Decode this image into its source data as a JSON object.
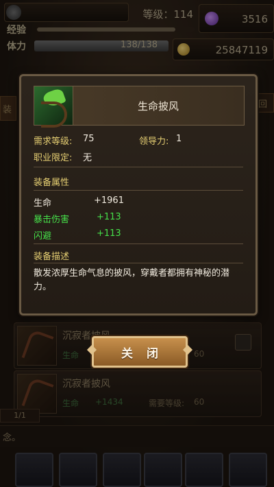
{
  "hud": {
    "player_name": "",
    "level_label": "等级：",
    "level": "114",
    "gems": "3516",
    "exp_label": "经验",
    "exp_fraction": 0.88,
    "hp_label": "体力",
    "hp_value": "138/138",
    "hp_fraction": 1.0,
    "gold": "25847119"
  },
  "side": {
    "left_tab": "装",
    "right_tab": "回"
  },
  "modal": {
    "item_name": "生命披风",
    "req_level_label": "需求等级:",
    "req_level": "75",
    "leadership_label": "领导力:",
    "leadership": "1",
    "job_label": "职业限定:",
    "job": "无",
    "attr_header": "装备属性",
    "attrs": [
      {
        "name": "生命",
        "value": "+1961"
      },
      {
        "name": "暴击伤害",
        "value": "+113"
      },
      {
        "name": "闪避",
        "value": "+113"
      }
    ],
    "desc_header": "装备描述",
    "desc": "散发浓厚生命气息的披风，穿戴者都拥有神秘的潜力。",
    "close_label": "关闭"
  },
  "list": [
    {
      "name": "沉寂者披风",
      "stat1": "生命",
      "stat2": "",
      "lv_label": "",
      "lv": "60"
    },
    {
      "name": "沉寂者披风",
      "stat1": "生命",
      "stat2": "+1434",
      "lv_label": "需要等级:",
      "lv": "60"
    }
  ],
  "page": "1/1",
  "bottom_text": "念。"
}
